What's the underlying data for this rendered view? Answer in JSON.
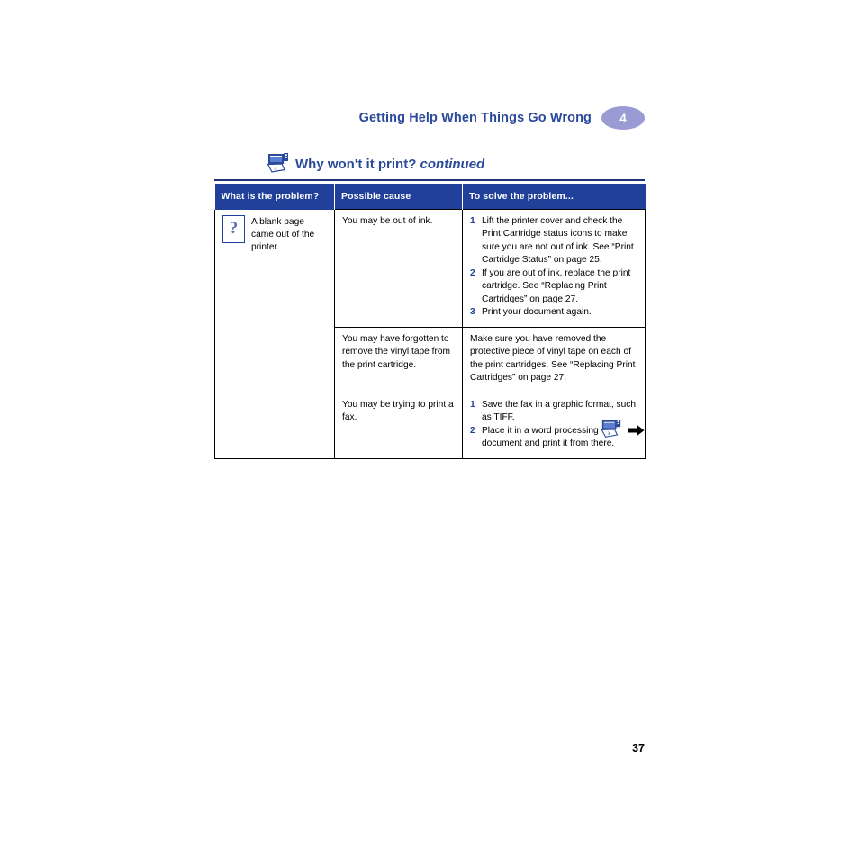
{
  "header": {
    "chapter_title": "Getting Help When Things Go Wrong",
    "chapter_number": "4",
    "badge_color": "#9b9bd4",
    "title_color": "#2b4a9b"
  },
  "section": {
    "icon": "fax-machine-icon",
    "title": "Why won't it print? ",
    "continued_label": "continued"
  },
  "table": {
    "accent_color": "#21409a",
    "columns": [
      {
        "label": "What is the problem?"
      },
      {
        "label": "Possible cause"
      },
      {
        "label": "To solve the problem..."
      }
    ],
    "problem": {
      "icon": "question-mark-icon",
      "text": "A blank page came out of the printer."
    },
    "rows": [
      {
        "cause": "You may be out of ink.",
        "solution_type": "ordered",
        "solution_steps": [
          "Lift the printer cover and check the Print Cartridge status icons to make sure you are not out of ink. See “Print Cartridge Status” on page 25.",
          "If you are out of ink, replace the print cartridge. See “Replacing Print Cartridges” on page 27.",
          "Print your document again."
        ]
      },
      {
        "cause": "You may have forgotten to remove the vinyl tape from the print cartridge.",
        "solution_type": "plain",
        "solution_text": "Make sure you have removed the protective piece of vinyl tape on each of the print cartridges. See “Replacing Print Cartridges” on page 27."
      },
      {
        "cause": "You may be trying to print a fax.",
        "solution_type": "ordered",
        "solution_steps": [
          "Save the fax in a graphic format, such as TIFF.",
          "Place it in a word processing document and print it from there."
        ]
      }
    ],
    "step_numbers": [
      "1",
      "2",
      "3"
    ]
  },
  "footer": {
    "icon": "fax-machine-icon",
    "next_icon": "arrow-right-icon",
    "page_number": "37"
  }
}
